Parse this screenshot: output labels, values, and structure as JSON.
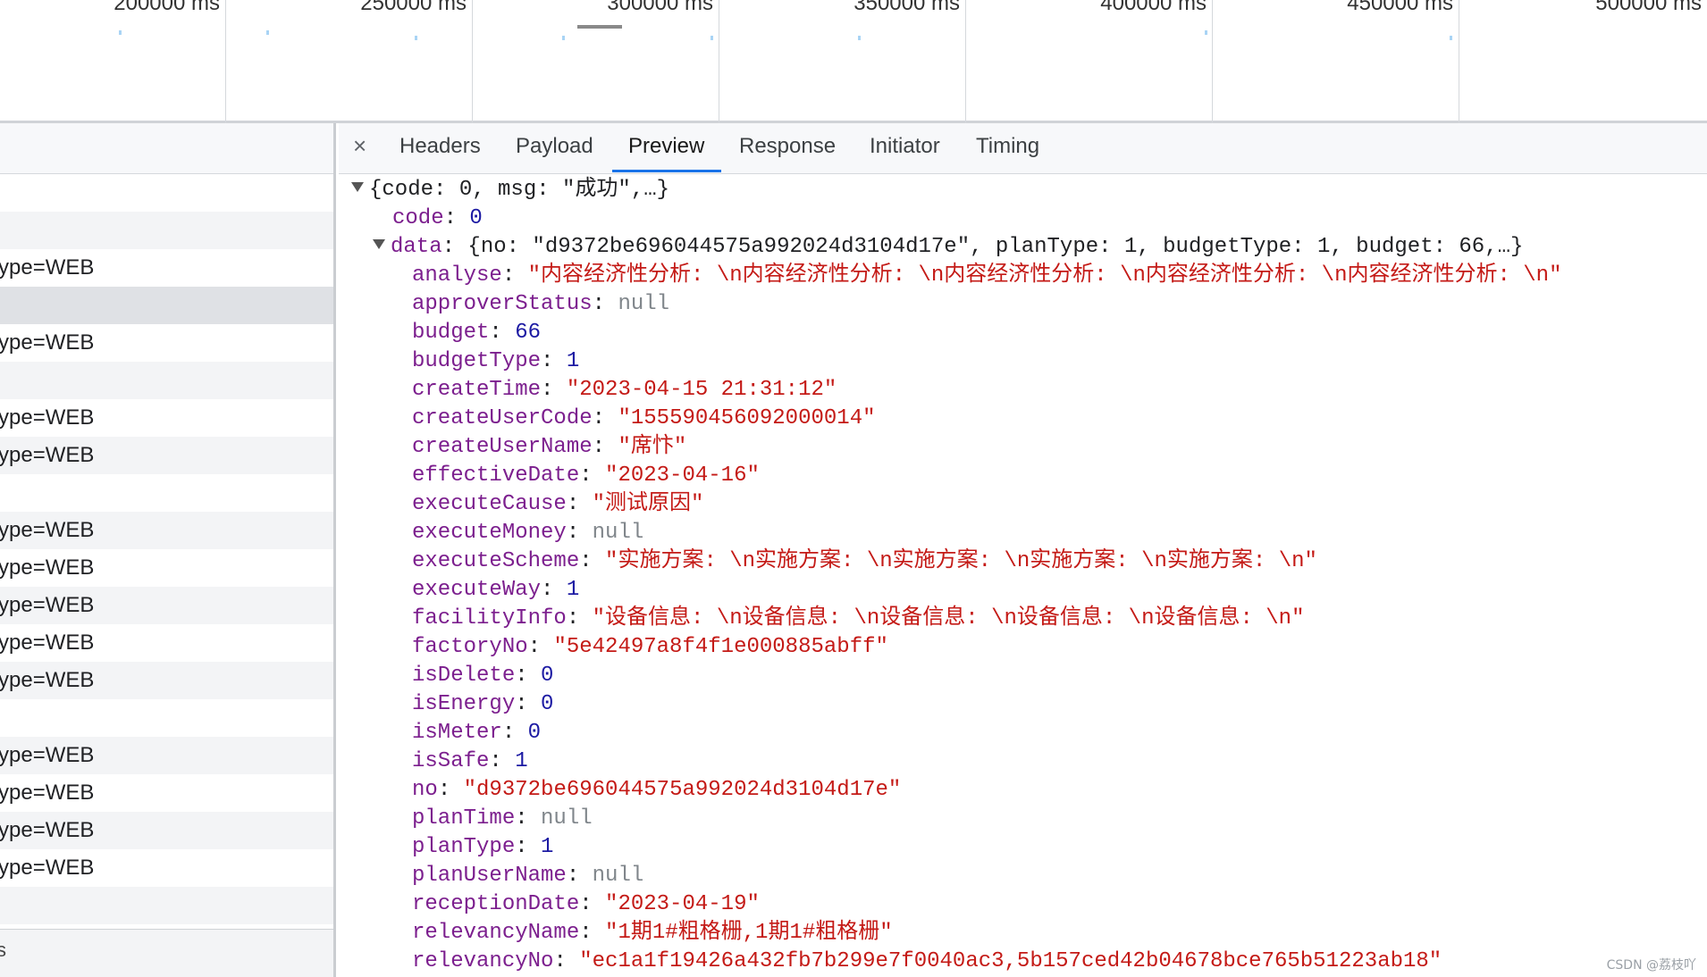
{
  "timeline": {
    "labels": [
      "200000 ms",
      "250000 ms",
      "300000 ms",
      "350000 ms",
      "400000 ms",
      "450000 ms",
      "500000 ms"
    ]
  },
  "request_list": {
    "rows": [
      {
        "text": ""
      },
      {
        "text": ""
      },
      {
        "text": "ype=WEB"
      },
      {
        "text": ""
      },
      {
        "text": "ype=WEB"
      },
      {
        "text": ""
      },
      {
        "text": "ype=WEB"
      },
      {
        "text": "ype=WEB"
      },
      {
        "text": ""
      },
      {
        "text": "ype=WEB"
      },
      {
        "text": "ype=WEB"
      },
      {
        "text": "ype=WEB"
      },
      {
        "text": "ype=WEB"
      },
      {
        "text": "ype=WEB"
      },
      {
        "text": ""
      },
      {
        "text": "ype=WEB"
      },
      {
        "text": "ype=WEB"
      },
      {
        "text": "ype=WEB"
      },
      {
        "text": "ype=WEB"
      },
      {
        "text": ""
      }
    ],
    "footer": "s"
  },
  "details": {
    "close": "×",
    "tabs": [
      "Headers",
      "Payload",
      "Preview",
      "Response",
      "Initiator",
      "Timing"
    ],
    "active_tab": "Preview"
  },
  "preview": {
    "root_summary": "{code: 0, msg: \"成功\",…}",
    "code_key": "code",
    "code_val": "0",
    "data_key": "data",
    "data_summary": "{no: \"d9372be696044575a992024d3104d17e\", planType: 1, budgetType: 1, budget: 66,…}",
    "fields": [
      {
        "key": "analyse",
        "val": "\"内容经济性分析: \\n内容经济性分析: \\n内容经济性分析: \\n内容经济性分析: \\n内容经济性分析: \\n\"",
        "kind": "str"
      },
      {
        "key": "approverStatus",
        "val": "null",
        "kind": "nul"
      },
      {
        "key": "budget",
        "val": "66",
        "kind": "num"
      },
      {
        "key": "budgetType",
        "val": "1",
        "kind": "num"
      },
      {
        "key": "createTime",
        "val": "\"2023-04-15 21:31:12\"",
        "kind": "str"
      },
      {
        "key": "createUserCode",
        "val": "\"155590456092000014\"",
        "kind": "str"
      },
      {
        "key": "createUserName",
        "val": "\"席忭\"",
        "kind": "str"
      },
      {
        "key": "effectiveDate",
        "val": "\"2023-04-16\"",
        "kind": "str"
      },
      {
        "key": "executeCause",
        "val": "\"测试原因\"",
        "kind": "str"
      },
      {
        "key": "executeMoney",
        "val": "null",
        "kind": "nul"
      },
      {
        "key": "executeScheme",
        "val": "\"实施方案: \\n实施方案: \\n实施方案: \\n实施方案: \\n实施方案: \\n\"",
        "kind": "str"
      },
      {
        "key": "executeWay",
        "val": "1",
        "kind": "num"
      },
      {
        "key": "facilityInfo",
        "val": "\"设备信息: \\n设备信息: \\n设备信息: \\n设备信息: \\n设备信息: \\n\"",
        "kind": "str"
      },
      {
        "key": "factoryNo",
        "val": "\"5e42497a8f4f1e000885abff\"",
        "kind": "str"
      },
      {
        "key": "isDelete",
        "val": "0",
        "kind": "num"
      },
      {
        "key": "isEnergy",
        "val": "0",
        "kind": "num"
      },
      {
        "key": "isMeter",
        "val": "0",
        "kind": "num"
      },
      {
        "key": "isSafe",
        "val": "1",
        "kind": "num"
      },
      {
        "key": "no",
        "val": "\"d9372be696044575a992024d3104d17e\"",
        "kind": "str"
      },
      {
        "key": "planTime",
        "val": "null",
        "kind": "nul"
      },
      {
        "key": "planType",
        "val": "1",
        "kind": "num"
      },
      {
        "key": "planUserName",
        "val": "null",
        "kind": "nul"
      },
      {
        "key": "receptionDate",
        "val": "\"2023-04-19\"",
        "kind": "str"
      },
      {
        "key": "relevancyName",
        "val": "\"1期1#粗格栅,1期1#粗格栅\"",
        "kind": "str"
      },
      {
        "key": "relevancyNo",
        "val": "\"ec1a1f19426a432fb7b299e7f0040ac3,5b157ced42b04678bce765b51223ab18\"",
        "kind": "str"
      }
    ]
  },
  "watermark": "CSDN @荔枝吖",
  "colors": {
    "key": "#7c1f8e",
    "string": "#c41a16",
    "number": "#1c1aa3",
    "null": "#80868b",
    "accent": "#1a73e8"
  }
}
